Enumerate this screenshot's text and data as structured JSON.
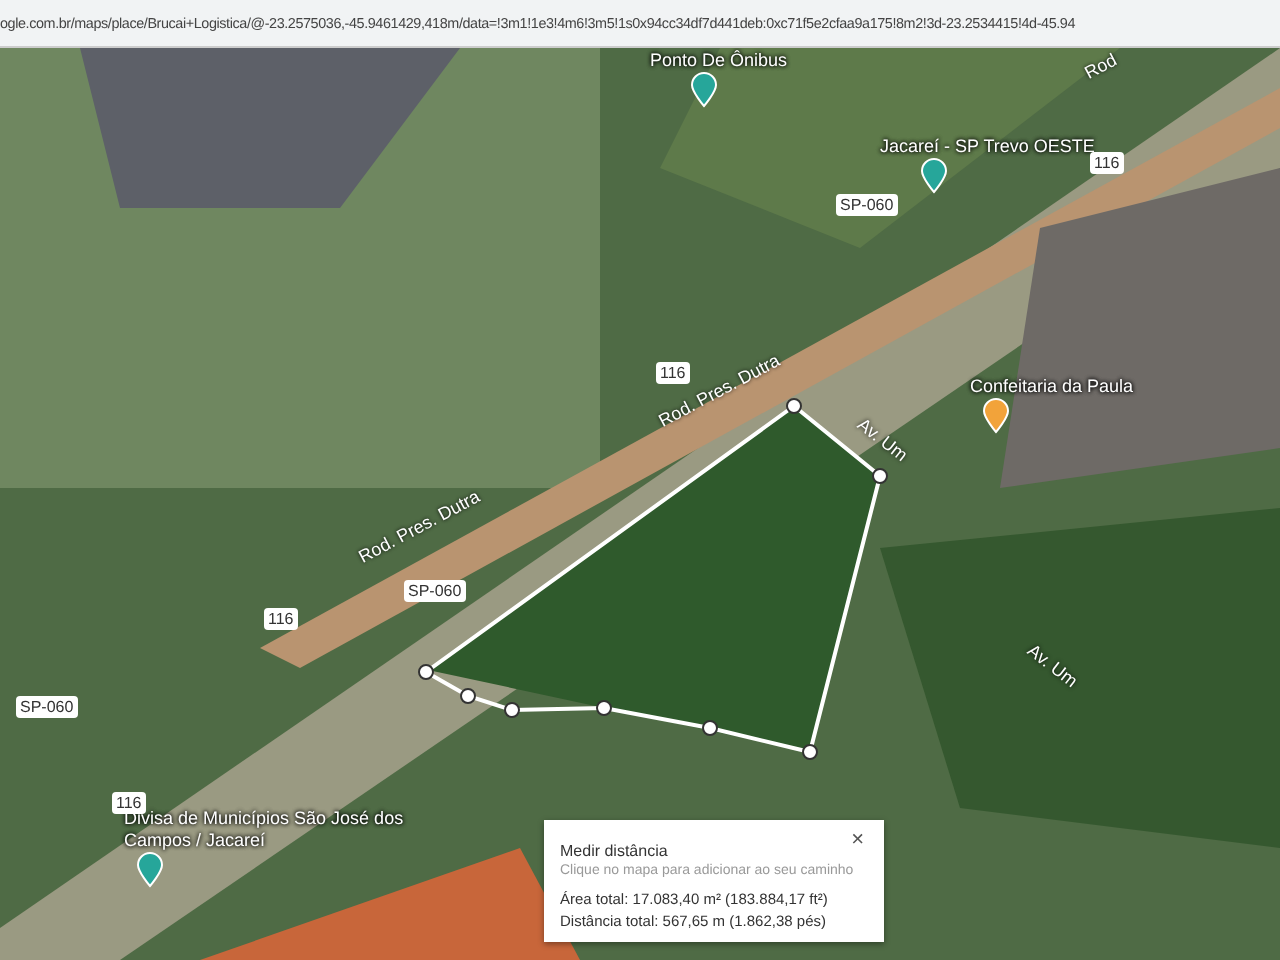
{
  "address_bar": {
    "url": "ogle.com.br/maps/place/Brucai+Logistica/@-23.2575036,-45.9461429,418m/data=!3m1!1e3!4m6!3m5!1s0x94cc34df7d441deb:0xc71f5e2cfaa9a175!8m2!3d-23.2534415!4d-45.94"
  },
  "map": {
    "places": [
      {
        "kind": "transit",
        "label": "Ponto De Ônibus"
      },
      {
        "kind": "transit",
        "label": "Jacareí - SP Trevo OESTE"
      },
      {
        "kind": "food",
        "label": "Confeitaria da Paula"
      },
      {
        "kind": "transit",
        "label": "Divisa de Municípios São José dos Campos / Jacareí"
      }
    ],
    "road_labels": [
      "Rod",
      "Rod. Pres. Dutra",
      "Rod. Pres. Dutra",
      "Av. Um",
      "Av. Um"
    ],
    "shields": [
      "116",
      "116",
      "116",
      "116",
      "SP-060",
      "SP-060",
      "SP-060"
    ]
  },
  "measure_panel": {
    "title": "Medir distância",
    "hint": "Clique no mapa para adicionar ao seu caminho",
    "close": "×",
    "area": "Área total: 17.083,40 m² (183.884,17 ft²)",
    "distance": "Distância total: 567,65 m (1.862,38 pés)"
  }
}
